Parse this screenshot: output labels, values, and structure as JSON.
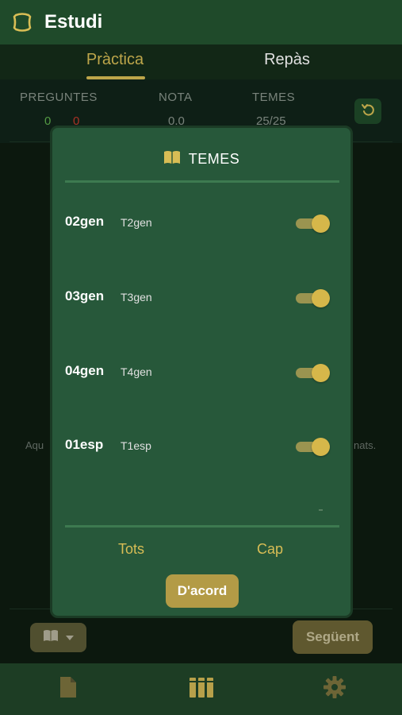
{
  "app": {
    "title": "Estudi"
  },
  "tabs": [
    {
      "label": "Pràctica",
      "active": true
    },
    {
      "label": "Repàs",
      "active": false
    }
  ],
  "stats": {
    "questions_label": "PREGUNTES",
    "correct": "0",
    "wrong": "0",
    "grade_label": "NOTA",
    "grade_value": "0.0",
    "topics_label": "TEMES",
    "topics_value": "25/25"
  },
  "background": {
    "message_left": "Aqu",
    "message_right": "nats."
  },
  "bottom_bar": {
    "next_label": "Següent"
  },
  "modal": {
    "title": "TEMES",
    "topics": [
      {
        "code": "02gen",
        "name": "T2gen",
        "enabled": true
      },
      {
        "code": "03gen",
        "name": "T3gen",
        "enabled": true
      },
      {
        "code": "04gen",
        "name": "T4gen",
        "enabled": true
      },
      {
        "code": "01esp",
        "name": "T1esp",
        "enabled": true
      }
    ],
    "select_all_label": "Tots",
    "select_none_label": "Cap",
    "ok_label": "D'acord"
  },
  "icons": {
    "logo": "badge-icon",
    "reset": "undo-icon",
    "topics": "book-open-icon",
    "dropdown": "chevron-down-icon",
    "nav_test": "document-icon",
    "nav_library": "library-icon",
    "nav_settings": "gear-icon"
  },
  "colors": {
    "accent": "#d8bd55",
    "header_bg": "#1f4a2a",
    "modal_bg": "#27583a",
    "correct": "#5fb04d",
    "wrong": "#c0392b"
  }
}
